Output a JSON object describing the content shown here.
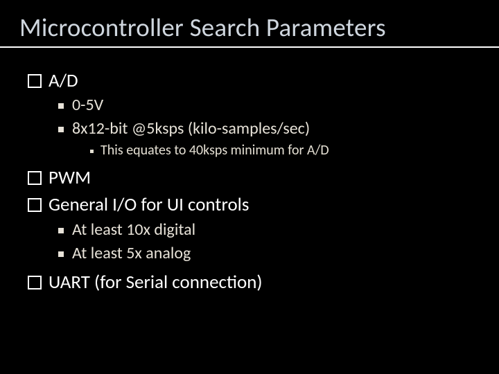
{
  "title": "Microcontroller Search Parameters",
  "items": {
    "ad": {
      "label": "A/D",
      "sub1": "0-5V",
      "sub2": "8x12-bit @5ksps (kilo-samples/sec)",
      "sub2a": "This equates to 40ksps minimum for A/D"
    },
    "pwm": {
      "label": "PWM"
    },
    "gio": {
      "label": "General I/O for UI controls",
      "sub1": "At least 10x digital",
      "sub2": "At least 5x analog"
    },
    "uart": {
      "label": "UART (for Serial connection)"
    }
  }
}
